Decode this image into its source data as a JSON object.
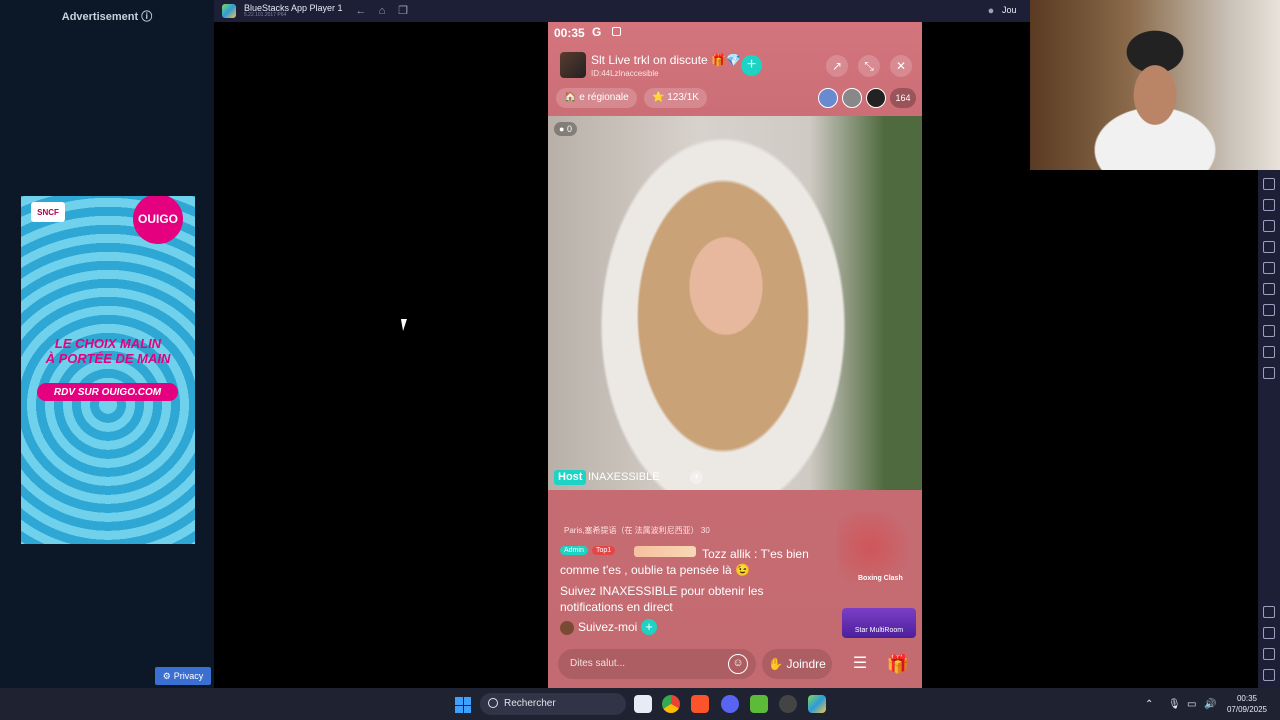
{
  "ad": {
    "heading": "Advertisement ⓘ",
    "sncf_logo": "SNCF",
    "ouigo_logo": "OUIGO",
    "headline": "LE CHOIX MALIN\nÀ PORTÉE DE MAIN",
    "cta": "RDV SUR OUIGO.COM",
    "privacy": "Privacy"
  },
  "bluestacks": {
    "title": "BlueStacks App Player 1",
    "version": "5.22.101.2017 P64",
    "join_label": "Jou"
  },
  "status_bar": {
    "time": "00:35",
    "google": "G"
  },
  "room": {
    "title": "Slt Live trkl on discute 🎁💎",
    "id": "ID:44LzInaccesible",
    "chip_region": "e régionale",
    "chip_level": "123/1K",
    "viewer_count": "164",
    "coins": "0"
  },
  "host": {
    "tag": "Host",
    "name": "INAXESSIBLE"
  },
  "chat": {
    "location": "Paris,塞希提语（在 法属波利尼西亚）  30",
    "admin_tag": "Admin",
    "top1_tag": "Top1",
    "user": "Tozz allik",
    "message": "Tozz allik : T'es bien comme t'es , oublie ta pensée là 😉",
    "follow_message": "Suivez INAXESSIBLE pour obtenir les notifications en direct",
    "follow_me": "Suivez-moi"
  },
  "widgets": {
    "boxing": "Boxing Clash",
    "multiroom": "Star MultiRoom"
  },
  "input": {
    "placeholder": "Dites salut...",
    "join": "Joindre"
  },
  "taskbar": {
    "search": "Rechercher",
    "time": "00:35",
    "date": "07/09/2025"
  }
}
